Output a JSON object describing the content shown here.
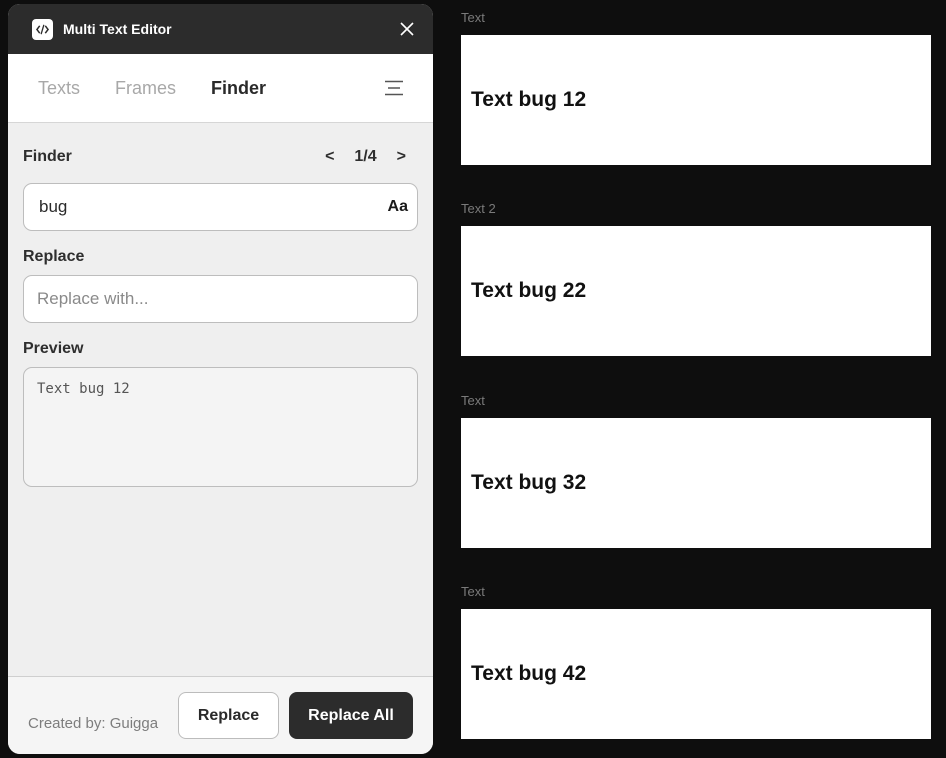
{
  "app": {
    "title": "Multi Text Editor"
  },
  "tabs": [
    {
      "label": "Texts",
      "active": false
    },
    {
      "label": "Frames",
      "active": false
    },
    {
      "label": "Finder",
      "active": true
    }
  ],
  "finder": {
    "label": "Finder",
    "pager": {
      "prev": "<",
      "position": "1/4",
      "next": ">"
    },
    "query": "bug",
    "case_toggle": "Aa"
  },
  "replace": {
    "label": "Replace",
    "placeholder": "Replace with...",
    "value": ""
  },
  "preview": {
    "label": "Preview",
    "text": "Text bug 12"
  },
  "footer": {
    "credit": "Created by: Guigga",
    "replace_button": "Replace",
    "replace_all_button": "Replace All"
  },
  "canvas": {
    "frames": [
      {
        "label": "Text",
        "text": "Text bug 12"
      },
      {
        "label": "Text 2",
        "text": "Text bug 22"
      },
      {
        "label": "Text",
        "text": "Text bug 32"
      },
      {
        "label": "Text",
        "text": "Text bug 42"
      }
    ]
  },
  "colors": {
    "titlebar": "#2c2c2c",
    "panel_bg": "#efefef",
    "canvas_bg": "#0e0e0e",
    "primary_button": "#2c2c2c"
  }
}
